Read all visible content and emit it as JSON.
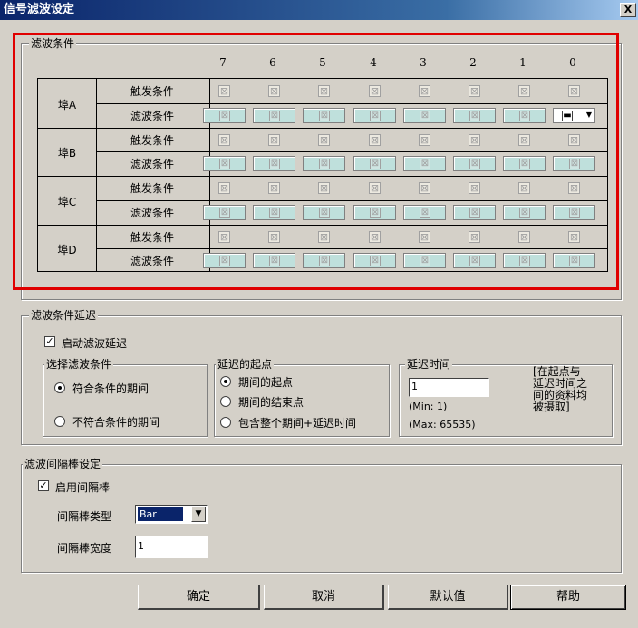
{
  "window": {
    "title": "信号滤波设定",
    "close_label": "X"
  },
  "filter_conditions": {
    "legend": "滤波条件",
    "bit_headers": [
      "7",
      "6",
      "5",
      "4",
      "3",
      "2",
      "1",
      "0"
    ],
    "groups": [
      {
        "label": "埠A",
        "rows": [
          "触发条件",
          "滤波条件"
        ]
      },
      {
        "label": "埠B",
        "rows": [
          "触发条件",
          "滤波条件"
        ]
      },
      {
        "label": "埠C",
        "rows": [
          "触发条件",
          "滤波条件"
        ]
      },
      {
        "label": "埠D",
        "rows": [
          "触发条件",
          "滤波条件"
        ]
      }
    ]
  },
  "delay": {
    "legend": "滤波条件延迟",
    "enable_label": "启动滤波延迟",
    "enable_checked": true,
    "select_group": {
      "legend": "选择滤波条件",
      "options": [
        "符合条件的期间",
        "不符合条件的期间"
      ],
      "selected": 0
    },
    "start_group": {
      "legend": "延迟的起点",
      "options": [
        "期间的起点",
        "期间的结束点",
        "包含整个期间+延迟时间"
      ],
      "selected": 0
    },
    "time_group": {
      "legend": "延迟时间",
      "value": "1",
      "min_label": "(Min: 1)",
      "max_label": "(Max: 65535)",
      "note_lines": [
        "[在起点与",
        "延迟时间之",
        "间的资料均",
        "被摄取]"
      ]
    }
  },
  "interval": {
    "legend": "滤波间隔棒设定",
    "enable_label": "启用间隔棒",
    "enable_checked": true,
    "type_label": "间隔棒类型",
    "type_value": "Bar",
    "width_label": "间隔棒宽度",
    "width_value": "1"
  },
  "buttons": {
    "ok": "确定",
    "cancel": "取消",
    "default": "默认值",
    "help": "帮助"
  },
  "colors": {
    "highlight": "#e00000",
    "filter_cell": "#bfe0dc",
    "title_bar": "#0a246a"
  }
}
